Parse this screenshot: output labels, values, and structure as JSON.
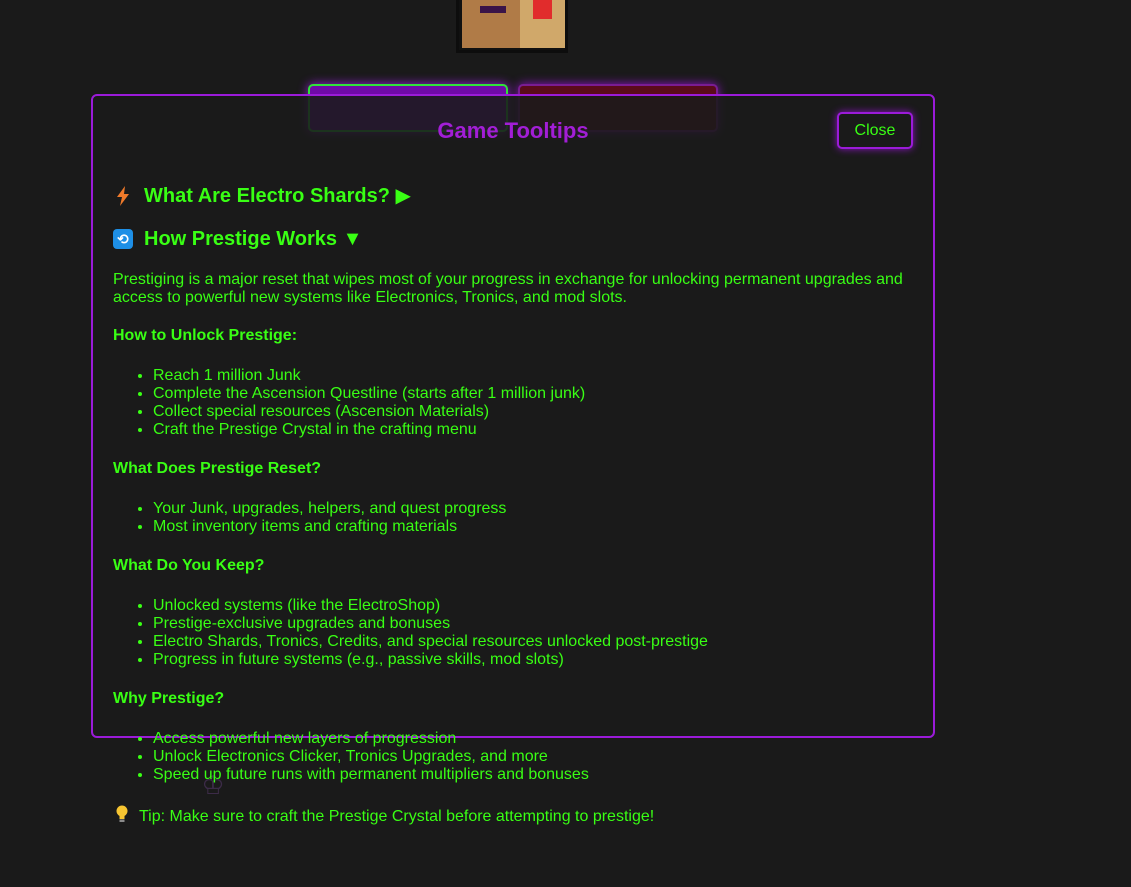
{
  "modal": {
    "title": "Game Tooltips",
    "close_label": "Close"
  },
  "sections": [
    {
      "icon": "lightning-bolt-icon",
      "title": "What Are Electro Shards? ▶"
    },
    {
      "icon": "repeat-icon",
      "title": "How Prestige Works ▼"
    }
  ],
  "prestige": {
    "intro": "Prestiging is a major reset that wipes most of your progress in exchange for unlocking permanent upgrades and access to powerful new systems like Electronics, Tronics, and mod slots.",
    "unlock_heading": "How to Unlock Prestige:",
    "unlock_items": [
      "Reach 1 million Junk",
      "Complete the Ascension Questline (starts after 1 million junk)",
      "Collect special resources (Ascension Materials)",
      "Craft the Prestige Crystal in the crafting menu"
    ],
    "reset_heading": "What Does Prestige Reset?",
    "reset_items": [
      "Your Junk, upgrades, helpers, and quest progress",
      "Most inventory items and crafting materials"
    ],
    "keep_heading": "What Do You Keep?",
    "keep_items": [
      "Unlocked systems (like the ElectroShop)",
      "Prestige-exclusive upgrades and bonuses",
      "Electro Shards, Tronics, Credits, and special resources unlocked post-prestige",
      "Progress in future systems (e.g., passive skills, mod slots)"
    ],
    "why_heading": "Why Prestige?",
    "why_items": [
      "Access powerful new layers of progression",
      "Unlock Electronics Clicker, Tronics Upgrades, and more",
      "Speed up future runs with permanent multipliers and bonuses"
    ],
    "tip": "Tip: Make sure to craft the Prestige Crystal before attempting to prestige!"
  },
  "colors": {
    "text": "#39ff14",
    "accent": "#9b1bd9",
    "background": "#1a1a1a"
  }
}
